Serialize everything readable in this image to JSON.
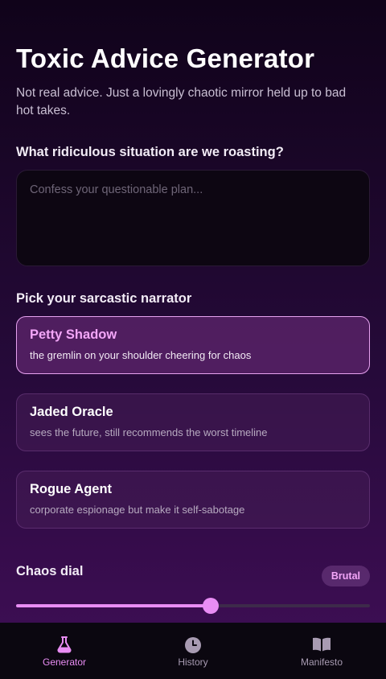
{
  "header": {
    "title": "Toxic Advice Generator",
    "subtitle": "Not real advice. Just a lovingly chaotic mirror held up to bad hot takes."
  },
  "situation": {
    "label": "What ridiculous situation are we roasting?",
    "placeholder": "Confess your questionable plan...",
    "value": ""
  },
  "narrator": {
    "label": "Pick your sarcastic narrator",
    "selected": "Petty Shadow",
    "options": [
      {
        "name": "Petty Shadow",
        "description": "the gremlin on your shoulder cheering for chaos"
      },
      {
        "name": "Jaded Oracle",
        "description": "sees the future, still recommends the worst timeline"
      },
      {
        "name": "Rogue Agent",
        "description": "corporate espionage but make it self-sabotage"
      }
    ]
  },
  "chaos": {
    "label": "Chaos dial",
    "level_label": "Brutal",
    "level_fraction": 0.55
  },
  "tabs": [
    {
      "label": "Generator",
      "icon": "flask-icon",
      "active": true
    },
    {
      "label": "History",
      "icon": "clock-icon",
      "active": false
    },
    {
      "label": "Manifesto",
      "icon": "book-icon",
      "active": false
    }
  ],
  "colors": {
    "accent": "#e98df4",
    "background": "#1a0628",
    "tabbar": "#0b0710"
  }
}
